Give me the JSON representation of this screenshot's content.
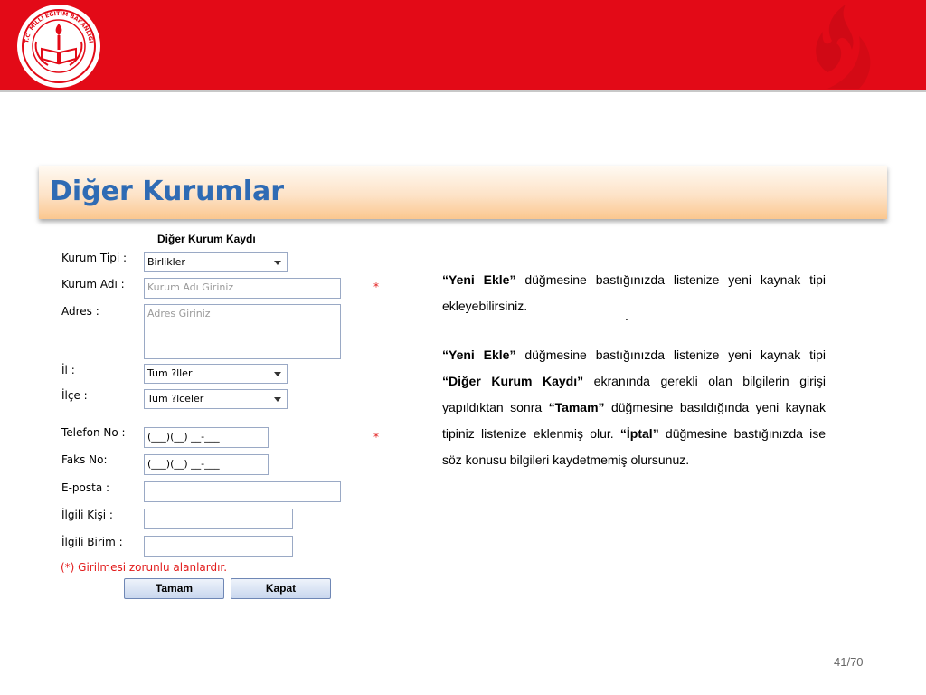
{
  "header": {
    "logo_text": "T.C. MİLLİ EĞİTİM BAKANLIĞI",
    "colors": {
      "band": "#e30a17",
      "title_text": "#2f6bb4",
      "required": "#e21b1b"
    }
  },
  "slide": {
    "title": "Diğer Kurumlar",
    "page_number": "41/70"
  },
  "form": {
    "title": "Diğer Kurum Kaydı",
    "labels": {
      "kurum_tipi": "Kurum Tipi :",
      "kurum_adi": "Kurum Adı :",
      "adres": "Adres :",
      "il": "İl :",
      "ilce": "İlçe :",
      "telefon": "Telefon No :",
      "faks": "Faks No:",
      "eposta": "E-posta :",
      "ilgili_kisi": "İlgili Kişi :",
      "ilgili_birim": "İlgili Birim :"
    },
    "kurum_tipi_value": "Birlikler",
    "kurum_adi_placeholder": "Kurum Adı Giriniz",
    "adres_placeholder": "Adres Giriniz",
    "il_value": "Tum ?ller",
    "ilce_value": "Tum ?lceler",
    "telefon_value": "(___)(__) __-___",
    "faks_value": "(___)(__) __-___",
    "eposta_value": "",
    "ilgili_kisi_value": "",
    "ilgili_birim_value": "",
    "required_mark": "*",
    "required_note": "(*) Girilmesi zorunlu alanlardır.",
    "buttons": {
      "ok": "Tamam",
      "close": "Kapat"
    }
  },
  "description": {
    "p1": {
      "b1": "“Yeni Ekle”",
      "t1": " düğmesine bastığınızda listenize yeni kaynak tipi ekleyebilirsiniz."
    },
    "dot": ".",
    "p2": {
      "b1": "“Yeni Ekle”",
      "t1": " düğmesine bastığınızda listenize yeni kaynak tipi ",
      "b2": "“Diğer Kurum Kaydı”",
      "t2": "  ekranında gerekli olan bilgilerin girişi yapıldıktan sonra ",
      "b3": "“Tamam”",
      "t3": " düğmesine basıldığında yeni kaynak tipiniz listenize eklenmiş olur. ",
      "b4": "“İptal”",
      "t4": " düğmesine bastığınızda ise söz konusu bilgileri kaydetmemiş olursunuz."
    }
  }
}
